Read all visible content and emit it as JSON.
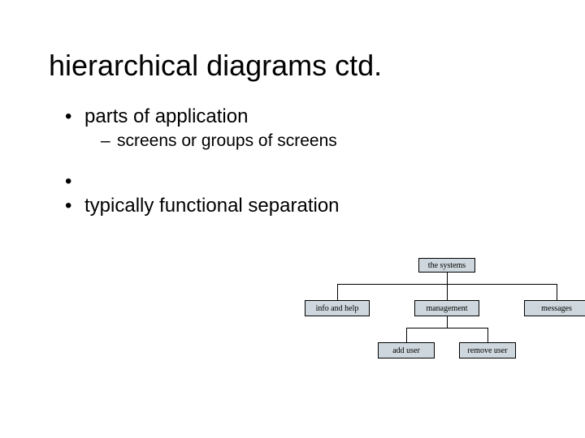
{
  "title": "hierarchical diagrams ctd.",
  "bullets": {
    "b1": "parts of application",
    "b1_sub": "screens or groups of screens",
    "b2": "typically functional separation"
  },
  "diagram": {
    "root": "the systems",
    "mid": {
      "a": "info and help",
      "b": "management",
      "c": "messages"
    },
    "leaf": {
      "a": "add user",
      "b": "remove user"
    }
  }
}
